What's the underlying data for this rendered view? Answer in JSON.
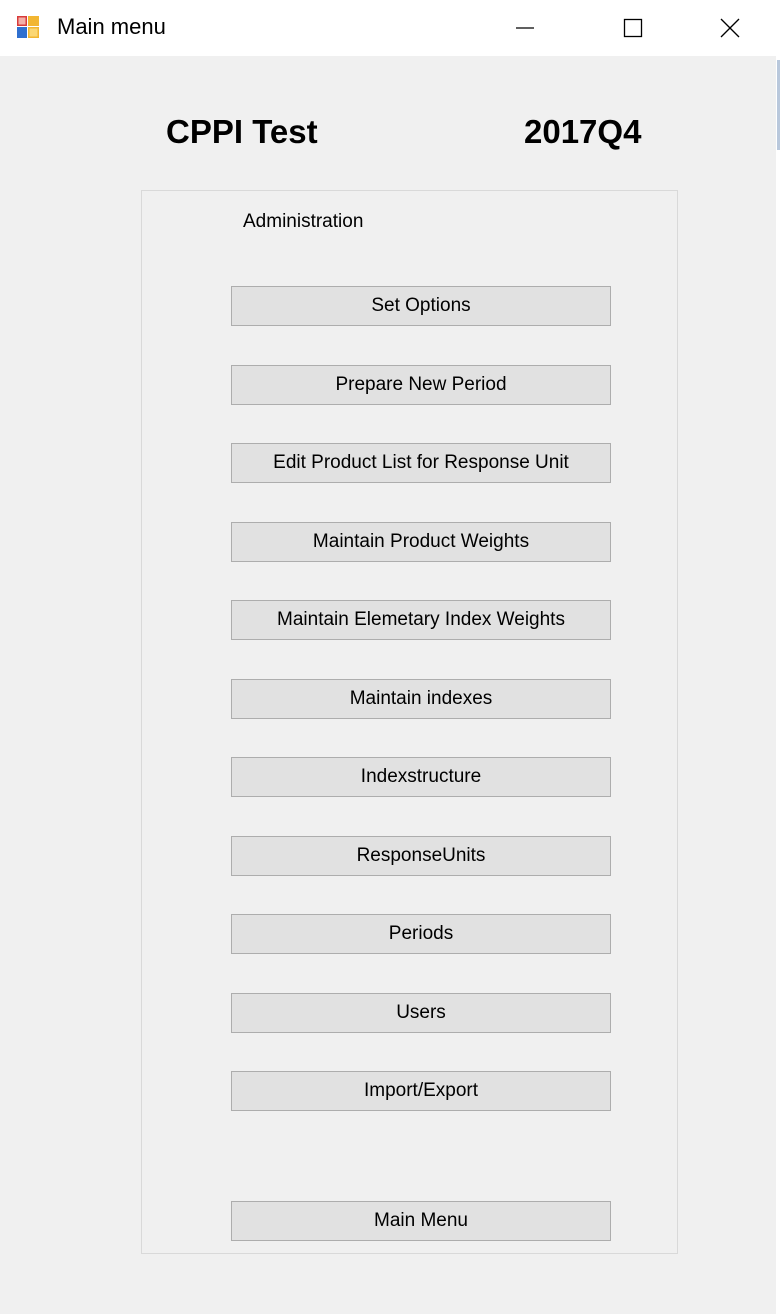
{
  "window": {
    "title": "Main menu"
  },
  "header": {
    "name": "CPPI Test",
    "period": "2017Q4"
  },
  "group": {
    "label": "Administration"
  },
  "buttons": [
    "Set Options",
    "Prepare New Period",
    "Edit Product List for Response Unit",
    "Maintain Product Weights",
    "Maintain Elemetary Index Weights",
    "Maintain indexes",
    "Indexstructure",
    "ResponseUnits",
    "Periods",
    "Users",
    "Import/Export"
  ],
  "footer": {
    "main_menu_label": "Main Menu"
  }
}
